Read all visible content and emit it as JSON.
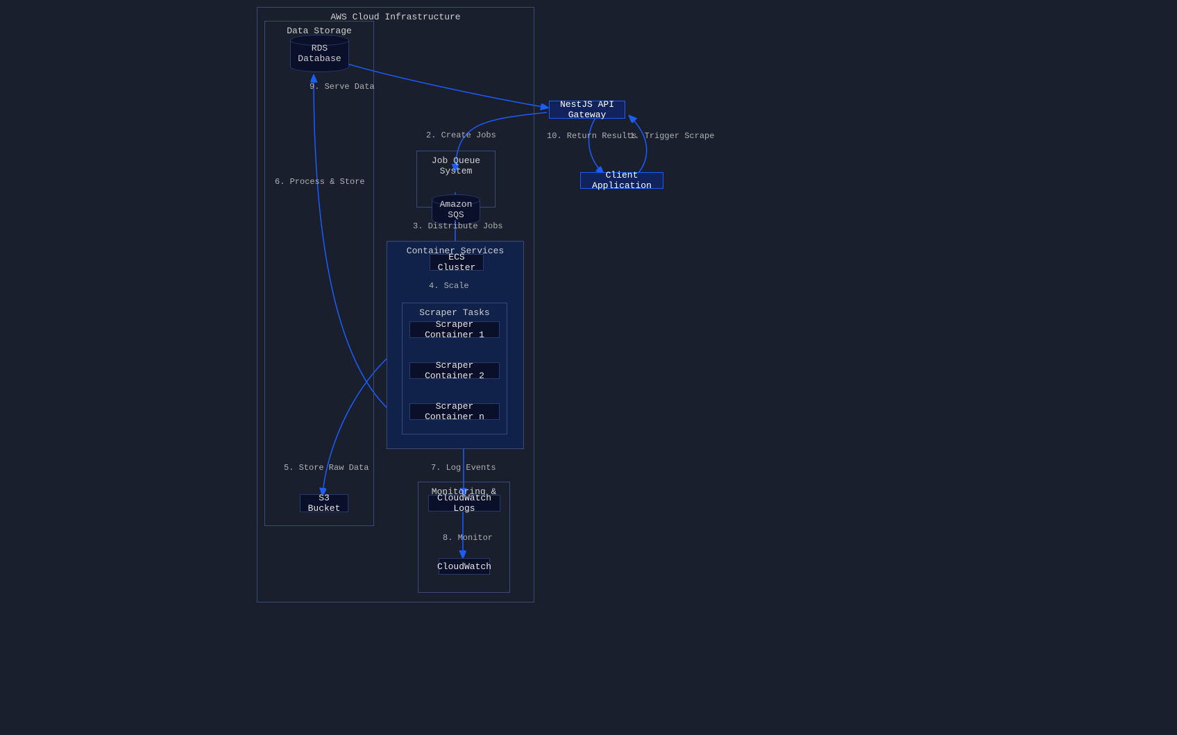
{
  "subgraphs": {
    "aws": {
      "title": "AWS Cloud Infrastructure"
    },
    "storage": {
      "title": "Data Storage"
    },
    "queue": {
      "title": "Job Queue System"
    },
    "container": {
      "title": "Container Services"
    },
    "tasks": {
      "title": "Scraper Tasks"
    },
    "monitoring": {
      "title": "Monitoring & Logging"
    }
  },
  "nodes": {
    "client": "Client Application",
    "api": "NestJS API Gateway",
    "sqs": "Amazon SQS",
    "ecs": "ECS Cluster",
    "scraper1": "Scraper Container 1",
    "scraper2": "Scraper Container 2",
    "scraper_n": "Scraper Container n",
    "s3": "S3 Bucket",
    "rds": "RDS Database",
    "logs": "CloudWatch Logs",
    "cw": "CloudWatch"
  },
  "edges": {
    "e1": "1. Trigger Scrape",
    "e2": "2. Create Jobs",
    "e3": "3. Distribute Jobs",
    "e4": "4. Scale",
    "e5": "5. Store Raw Data",
    "e6": "6. Process & Store",
    "e7": "7. Log Events",
    "e8": "8. Monitor",
    "e9": "9. Serve Data",
    "e10": "10. Return Results"
  }
}
